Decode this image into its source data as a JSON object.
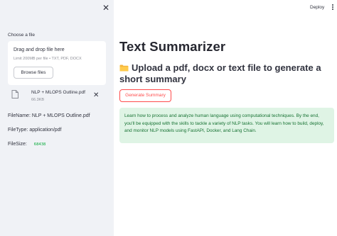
{
  "sidebar": {
    "close_icon": "close-icon",
    "uploader_label": "Choose a file",
    "dropzone": {
      "title": "Drag and drop file here",
      "limit": "Limit 200MB per file • TXT, PDF, DOCX",
      "browse_label": "Browse files"
    },
    "file": {
      "name": "NLP + MLOPS Outline.pdf",
      "size": "66.3KB",
      "remove_icon": "close-icon"
    },
    "info": {
      "filename_line": "FileName: NLP + MLOPS Outline.pdf",
      "filetype_line": "FileType: application/pdf",
      "filesize_label": "FileSize:",
      "filesize_value": "68438"
    }
  },
  "header": {
    "deploy_label": "Deploy",
    "menu_icon": "kebab-menu-icon"
  },
  "main": {
    "title": "Text Summarizer",
    "subheading_icon": "folder-icon",
    "subheading": "Upload a pdf, docx or text file to generate a short summary",
    "generate_label": "Generate Summary",
    "summary": "Learn how to process and analyze human language using computational techniques. By the end, you'll be equipped with the skills to tackle a variety of NLP tasks. You will learn how to build, deploy, and monitor NLP models using FastAPI, Docker, and Lang Chain."
  },
  "colors": {
    "sidebar_bg": "#f0f2f6",
    "accent": "#ff4b4b",
    "success_bg": "#dff4e5",
    "success_text": "#177233",
    "code_green": "#09ab3b"
  }
}
